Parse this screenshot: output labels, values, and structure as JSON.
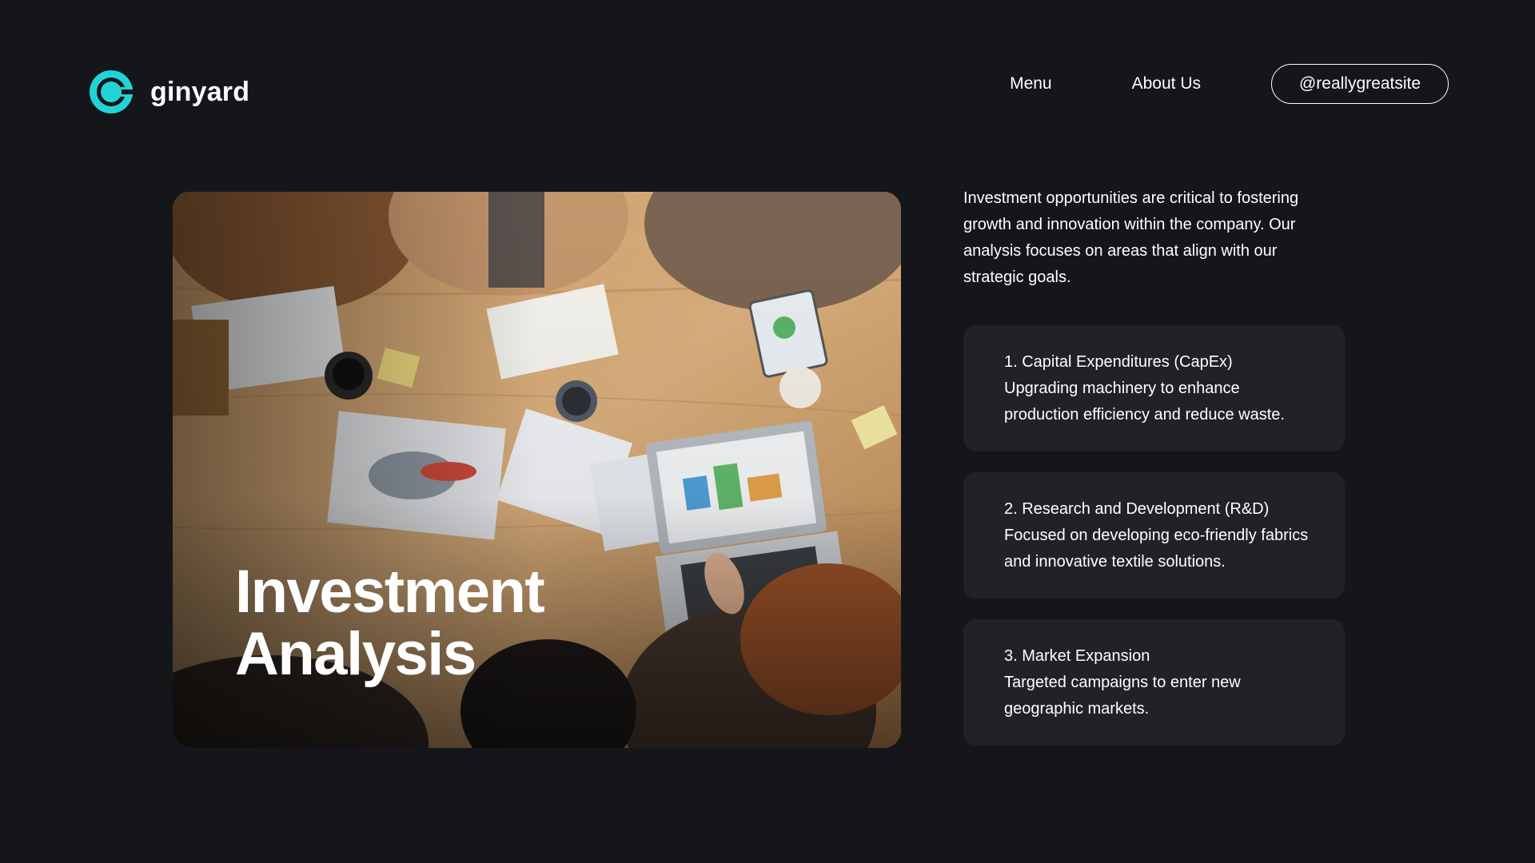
{
  "brand": {
    "name": "ginyard",
    "logo_color": "#22d3d6"
  },
  "nav": {
    "menu_label": "Menu",
    "about_label": "About Us",
    "handle_label": "@reallygreatsite"
  },
  "hero": {
    "title_line1": "Investment",
    "title_line2": "Analysis",
    "image_description": "team-meeting-photo"
  },
  "intro": "Investment opportunities are critical to fostering growth and innovation within the company. Our analysis focuses on areas that align with our strategic goals.",
  "items": [
    {
      "heading": "1. Capital Expenditures (CapEx)",
      "body": "Upgrading machinery to enhance production efficiency and reduce waste."
    },
    {
      "heading": "2. Research and Development (R&D)",
      "body": "Focused on developing eco-friendly fabrics and innovative textile solutions."
    },
    {
      "heading": "3. Market Expansion",
      "body": "Targeted campaigns to enter new geographic markets."
    }
  ],
  "colors": {
    "background": "#14161a",
    "card": "#202226",
    "accent": "#22d3d6"
  }
}
